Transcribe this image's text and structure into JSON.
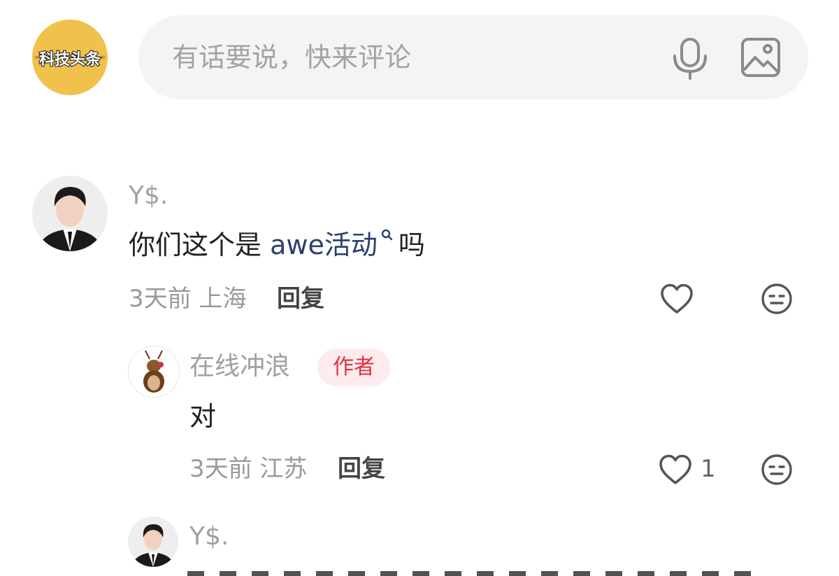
{
  "header": {
    "logo_icon": "keji-toutiao-logo",
    "logo_text": "科技头条",
    "placeholder": "有话要说，快来评论",
    "mic_icon": "microphone-icon",
    "image_icon": "image-icon"
  },
  "comments": [
    {
      "username": "Y$.",
      "text_before": "你们这个是 ",
      "topic": "awe活动",
      "text_after": "吗",
      "time": "3天前",
      "location": "上海",
      "reply_label": "回复"
    }
  ],
  "replies": [
    {
      "username": "在线冲浪",
      "badge": "作者",
      "text": "对",
      "time": "3天前",
      "location": "江苏",
      "reply_label": "回复",
      "likes": "1"
    },
    {
      "username": "Y$."
    }
  ],
  "colors": {
    "logo_bg": "#f0c14b",
    "link": "#2b3f6f",
    "badge_text": "#e0303e",
    "badge_bg": "#fdebed"
  }
}
